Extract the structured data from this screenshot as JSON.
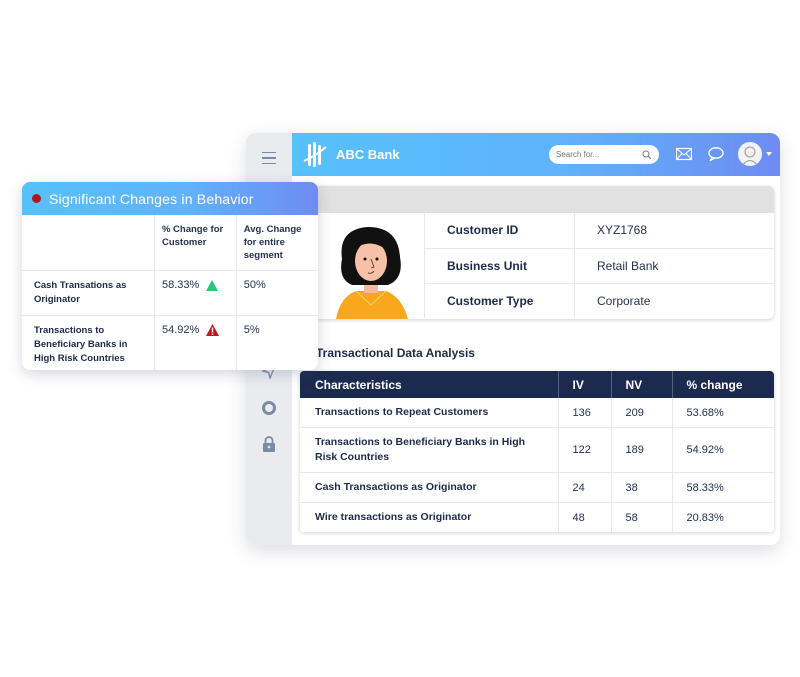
{
  "app": {
    "brand": "ABC Bank",
    "search": {
      "placeholder": "Search for..."
    },
    "icons": [
      "hamburger-menu-icon",
      "send-icon",
      "gear-icon",
      "lock-icon",
      "search-icon",
      "mail-icon",
      "chat-icon",
      "user-avatar-icon",
      "caret-down-icon"
    ]
  },
  "customer": {
    "fields": [
      {
        "label": "Customer ID",
        "value": "XYZ1768"
      },
      {
        "label": "Business Unit",
        "value": "Retail Bank"
      },
      {
        "label": "Customer Type",
        "value": "Corporate"
      }
    ]
  },
  "analysis": {
    "title": "Transactional Data Analysis",
    "columns": [
      "Characteristics",
      "IV",
      "NV",
      "% change"
    ],
    "rows": [
      {
        "name": "Transactions to Repeat Customers",
        "iv": "136",
        "nv": "209",
        "change": "53.68%"
      },
      {
        "name": "Transactions to Beneficiary Banks in High Risk Countries",
        "iv": "122",
        "nv": "189",
        "change": "54.92%"
      },
      {
        "name": "Cash Transactions as Originator",
        "iv": "24",
        "nv": "38",
        "change": "58.33%"
      },
      {
        "name": "Wire transactions as Originator",
        "iv": "48",
        "nv": "58",
        "change": "20.83%"
      }
    ]
  },
  "popup": {
    "title": "Significant Changes in Behavior",
    "status_color": "#b3151a",
    "columns": [
      "",
      "% Change for Customer",
      "Avg. Change for entire segment"
    ],
    "rows": [
      {
        "label": "Cash Transations as Originator",
        "change": "58.33%",
        "indicator": "up-arrow-icon",
        "indicator_color": "#27c77a",
        "avg": "50%"
      },
      {
        "label": "Transactions to Beneficiary Banks in High Risk Countries",
        "change": "54.92%",
        "indicator": "warning-icon",
        "indicator_color": "#c2171d",
        "avg": "5%"
      }
    ]
  }
}
